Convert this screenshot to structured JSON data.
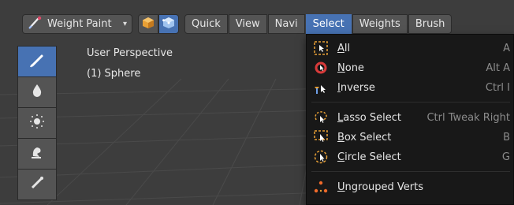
{
  "header": {
    "mode_label": "Weight Paint",
    "menus": [
      "Quick",
      "View",
      "Navi",
      "Select",
      "Weights",
      "Brush"
    ],
    "active_menu": "Select"
  },
  "viewport": {
    "perspective": "User Perspective",
    "object": "(1) Sphere"
  },
  "toolbar": {
    "tools": [
      "draw-brush-icon",
      "blur-drop-icon",
      "average-icon",
      "smear-icon",
      "gradient-icon"
    ]
  },
  "select_menu": {
    "items": [
      {
        "underline": "A",
        "rest": "ll",
        "shortcut": "A",
        "icon": "select-all-icon"
      },
      {
        "underline": "N",
        "rest": "one",
        "shortcut": "Alt A",
        "icon": "select-none-icon"
      },
      {
        "underline": "I",
        "rest": "nverse",
        "shortcut": "Ctrl I",
        "icon": "select-inverse-icon"
      },
      {
        "underline": "L",
        "rest": "asso Select",
        "shortcut": "Ctrl Tweak Right",
        "icon": "lasso-select-icon"
      },
      {
        "underline": "B",
        "rest": "ox Select",
        "shortcut": "B",
        "icon": "box-select-icon"
      },
      {
        "underline": "C",
        "rest": "ircle Select",
        "shortcut": "G",
        "icon": "circle-select-icon"
      },
      {
        "underline": "U",
        "rest": "ngrouped Verts",
        "shortcut": "",
        "icon": "ungrouped-verts-icon"
      }
    ]
  },
  "colors": {
    "accent": "#4772b3",
    "menu_bg": "#181818",
    "viewport_bg": "#3d3d3d",
    "icon_orange": "#e8a035"
  }
}
